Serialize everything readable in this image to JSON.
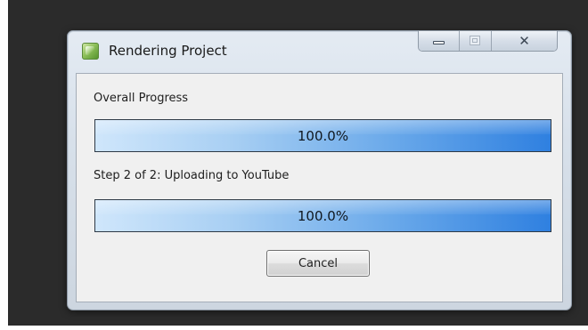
{
  "window": {
    "title": "Rendering Project",
    "icon": "app-icon",
    "controls": {
      "minimize_icon": "minimize-icon",
      "maximize_icon": "maximize-icon",
      "close_glyph": "✕"
    }
  },
  "overall": {
    "label": "Overall Progress",
    "percent_text": "100.0%",
    "fraction": 1.0
  },
  "step": {
    "label": "Step 2 of 2: Uploading to YouTube",
    "percent_text": "100.0%",
    "fraction": 1.0
  },
  "buttons": {
    "cancel": "Cancel"
  },
  "colors": {
    "progress_start": "#cfe6fb",
    "progress_end": "#2f80e0",
    "desktop_background": "#2b2b2b"
  }
}
